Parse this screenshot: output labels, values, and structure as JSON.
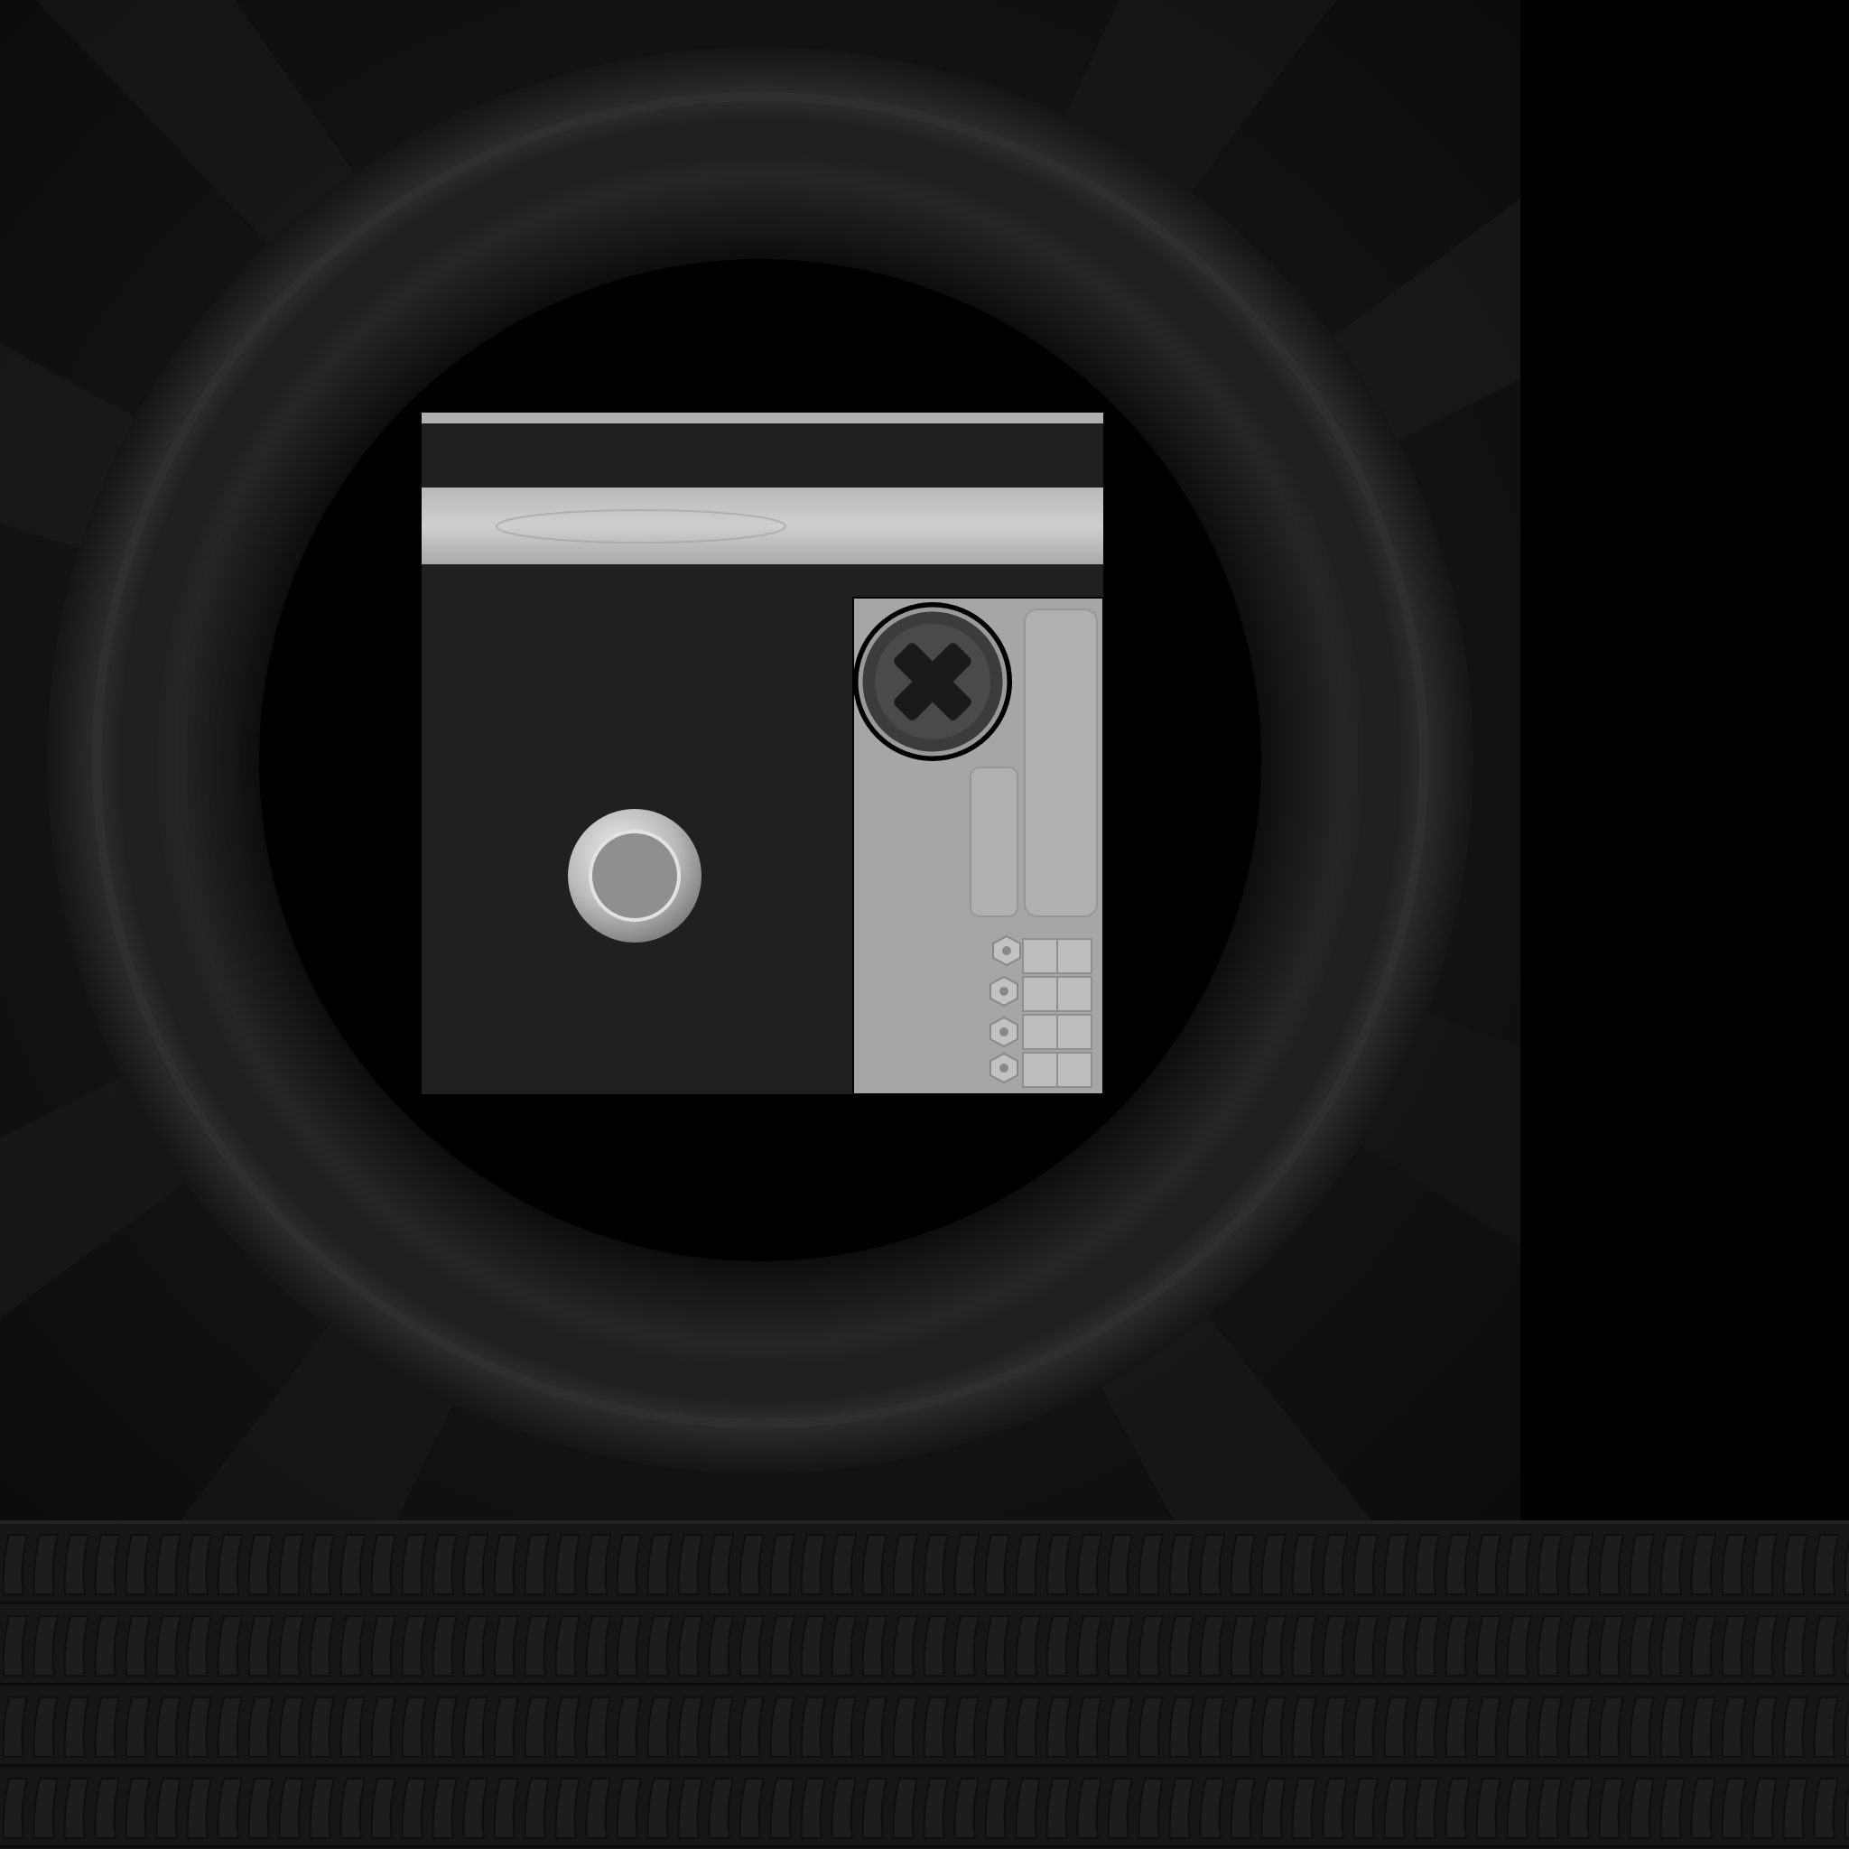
{
  "texture_sheet": {
    "kind": "tire and wheel texture atlas",
    "colors": {
      "background": "#000000",
      "sidewall_dark": "#141414",
      "sidewall_ring": "#2a2a2a",
      "inner_hole": "#000000",
      "uv_panel_dark": "#202020",
      "uv_panel_light": "#a6a6a6",
      "uv_strip_light": "#b4b4b4",
      "tread_base": "#161616",
      "tread_block": "#1d1d1d"
    },
    "regions": [
      {
        "name": "sidewall-ring",
        "shape": "circle ring"
      },
      {
        "name": "radial-spokes-background",
        "shape": "radial streaks"
      },
      {
        "name": "inner-uv-square",
        "shape": "square"
      },
      {
        "name": "top-light-strip",
        "shape": "horizontal strip"
      },
      {
        "name": "right-light-panel",
        "shape": "rectangle"
      },
      {
        "name": "hubcap-button",
        "shape": "circle"
      },
      {
        "name": "cross-bolt-emblem",
        "shape": "circle with X"
      },
      {
        "name": "lug-nut-row",
        "shape": "small hexagons"
      },
      {
        "name": "tread-strip",
        "shape": "long horizontal band"
      }
    ],
    "icons": [
      "cross-bolt-icon",
      "hubcap-icon",
      "lug-nut-icon"
    ],
    "tread_rows": 4
  }
}
